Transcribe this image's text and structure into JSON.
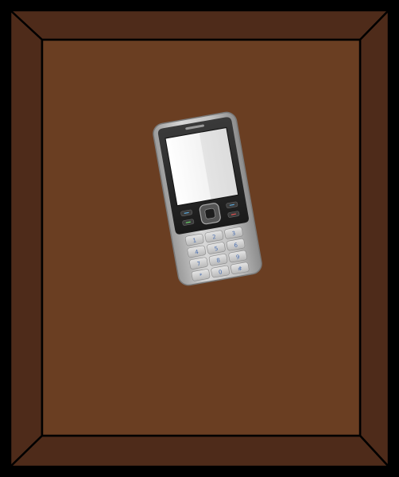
{
  "scene": {
    "container": "open-cardboard-box",
    "item": "mobile-phone",
    "colors": {
      "background": "#000000",
      "box_wall": "#4e2b1a",
      "box_floor": "#6a3e22",
      "edge": "#000000",
      "phone_body": "#c9c9c9",
      "phone_face": "#2a2a2a",
      "screen": "#f2f2f2"
    }
  },
  "keypad": {
    "keys": [
      "1",
      "2",
      "3",
      "4",
      "5",
      "6",
      "7",
      "8",
      "9",
      "*",
      "0",
      "#"
    ]
  }
}
